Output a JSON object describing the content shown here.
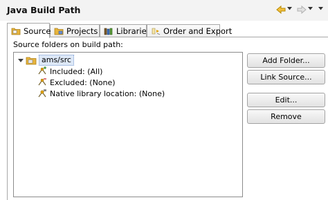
{
  "window": {
    "title": "Java Build Path"
  },
  "nav": {
    "back_icon": "back-arrow-icon",
    "forward_icon": "forward-arrow-icon",
    "dropdown_icon": "chevron-down-icon",
    "back_color": "#e0a000",
    "forward_color": "#c4c4c4"
  },
  "tabs": [
    {
      "label": "Source",
      "icon": "source-folder-icon",
      "active": true
    },
    {
      "label": "Projects",
      "icon": "projects-icon",
      "active": false
    },
    {
      "label": "Libraries",
      "icon": "libraries-icon",
      "active": false
    },
    {
      "label": "Order and Export",
      "icon": "order-export-icon",
      "active": false
    }
  ],
  "source_panel": {
    "label": "Source folders on build path:",
    "tree": {
      "root": {
        "label": "ams/src",
        "expanded": true,
        "icon": "package-folder-icon"
      },
      "children": [
        {
          "label": "Included: (All)",
          "icon": "filter-included-icon"
        },
        {
          "label": "Excluded: (None)",
          "icon": "filter-excluded-icon"
        },
        {
          "label": "Native library location: (None)",
          "icon": "native-library-icon"
        }
      ]
    }
  },
  "buttons": {
    "add_folder": "Add Folder...",
    "link_source": "Link Source...",
    "edit": "Edit...",
    "remove": "Remove"
  },
  "colors": {
    "selection_bg": "#dde8f7",
    "folder": "#e7b43c",
    "border": "#a7a7a7"
  }
}
